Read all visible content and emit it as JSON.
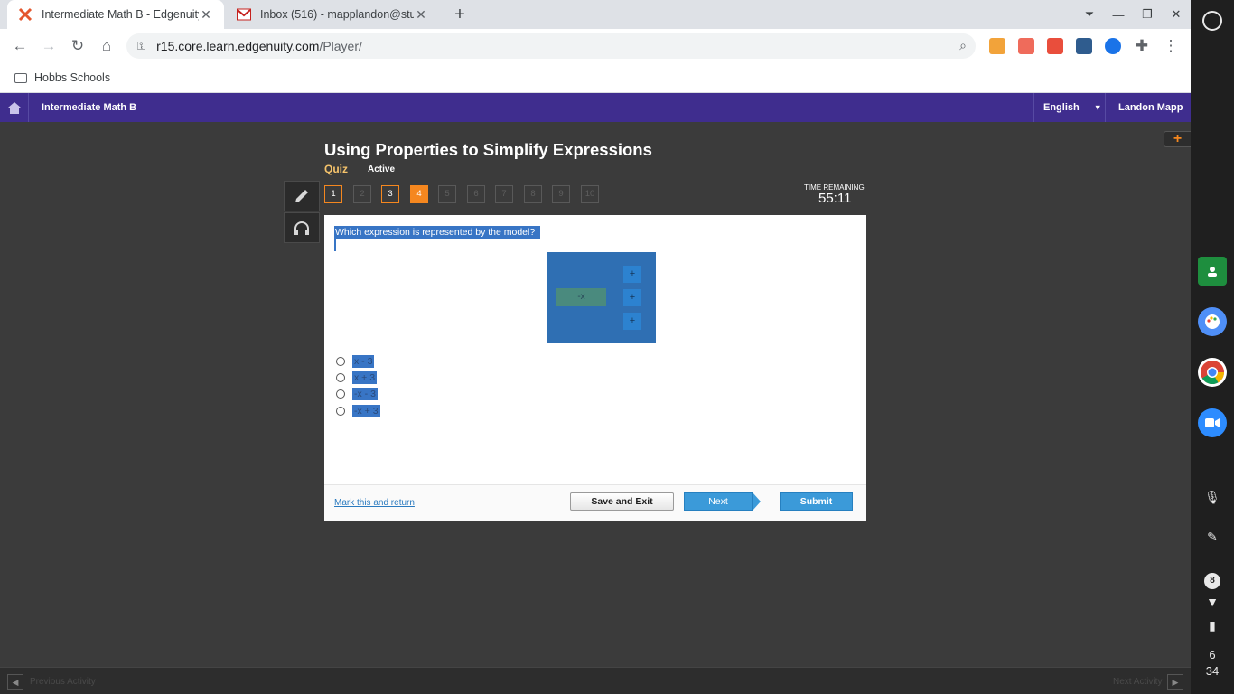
{
  "browser": {
    "tabs": [
      {
        "title": "Intermediate Math B - Edgenuity",
        "close": "✕"
      },
      {
        "title": "Inbox (516) - mapplandon@stud",
        "close": "✕"
      }
    ],
    "new_tab": "+",
    "url_host": "r15.core.learn.edgenuity.com",
    "url_path": "/Player/",
    "bookmark": "Hobbs Schools"
  },
  "header": {
    "course": "Intermediate Math B",
    "language": "English",
    "user": "Landon Mapp"
  },
  "lesson": {
    "title": "Using Properties to Simplify Expressions",
    "type": "Quiz",
    "status": "Active"
  },
  "question_nav": {
    "items": [
      "1",
      "2",
      "3",
      "4",
      "5",
      "6",
      "7",
      "8",
      "9",
      "10"
    ],
    "current": "4",
    "answered": [
      "1",
      "3"
    ]
  },
  "timer": {
    "label": "TIME REMAINING",
    "value": "55:11"
  },
  "question": {
    "prompt": "Which expression is represented by the model?",
    "model": {
      "negative_tile": "-x",
      "positive_tiles": [
        "+",
        "+",
        "+"
      ]
    },
    "options": [
      "x - 3",
      "x + 3",
      "-x - 3",
      "-x + 3"
    ]
  },
  "actions": {
    "mark": "Mark this and return",
    "save": "Save and Exit",
    "next": "Next",
    "submit": "Submit"
  },
  "bottom": {
    "prev": "Previous Activity",
    "next": "Next Activity"
  },
  "shelf": {
    "notifications": "8",
    "time_hour": "6",
    "time_min": "34"
  },
  "colors": {
    "brand_purple": "#3f2d8e",
    "accent_orange": "#f5871f",
    "selection_blue": "#3875c5",
    "button_blue": "#3b9ad9"
  }
}
